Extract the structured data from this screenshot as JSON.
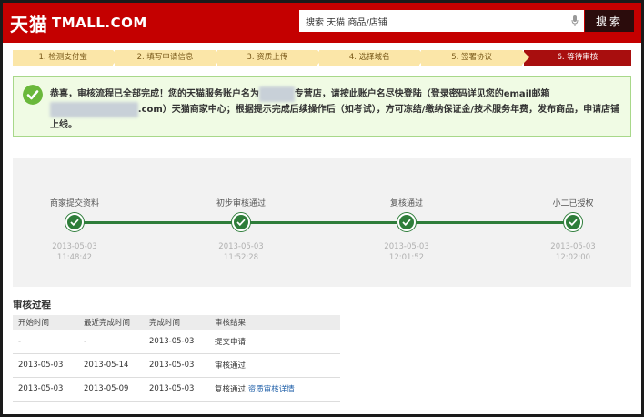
{
  "header": {
    "logo_cn": "天猫",
    "logo_en": "TMALL.COM",
    "search_value": "搜索 天猫 商品/店铺",
    "search_button": "搜索",
    "brand_color": "#c40000"
  },
  "steps": [
    {
      "label": "1. 检测支付宝"
    },
    {
      "label": "2. 填写申请信息"
    },
    {
      "label": "3. 资质上传"
    },
    {
      "label": "4. 选择域名"
    },
    {
      "label": "5. 签署协议"
    },
    {
      "label": "6. 等待审核"
    }
  ],
  "success": {
    "line1_pre": "恭喜，审核流程已全部完成！您的天猫服务账户名为",
    "line1_post": "专营店，请按此账户名尽快登陆（登录密码详见您的email邮箱",
    "line2_post": ".com）天猫商家中心；根据提示完成后续操作后（如考试），方可冻结/缴纳保证金/技术服务年费，发布商品，申请店铺",
    "line3": "上线。"
  },
  "timeline": [
    {
      "label": "商家提交资料",
      "date": "2013-05-03",
      "time": "11:48:42"
    },
    {
      "label": "初步审核通过",
      "date": "2013-05-03",
      "time": "11:52:28"
    },
    {
      "label": "复核通过",
      "date": "2013-05-03",
      "time": "12:01:52"
    },
    {
      "label": "小二已授权",
      "date": "2013-05-03",
      "time": "12:02:00"
    }
  ],
  "review": {
    "title": "审核过程",
    "headers": [
      "开始时间",
      "最近完成时间",
      "完成时间",
      "审核结果"
    ],
    "rows": [
      {
        "start": "-",
        "recent": "-",
        "done": "2013-05-03",
        "result": "提交申请",
        "link": ""
      },
      {
        "start": "2013-05-03",
        "recent": "2013-05-14",
        "done": "2013-05-03",
        "result": "审核通过",
        "link": ""
      },
      {
        "start": "2013-05-03",
        "recent": "2013-05-09",
        "done": "2013-05-03",
        "result": "复核通过",
        "link": "资质审核详情"
      }
    ]
  }
}
